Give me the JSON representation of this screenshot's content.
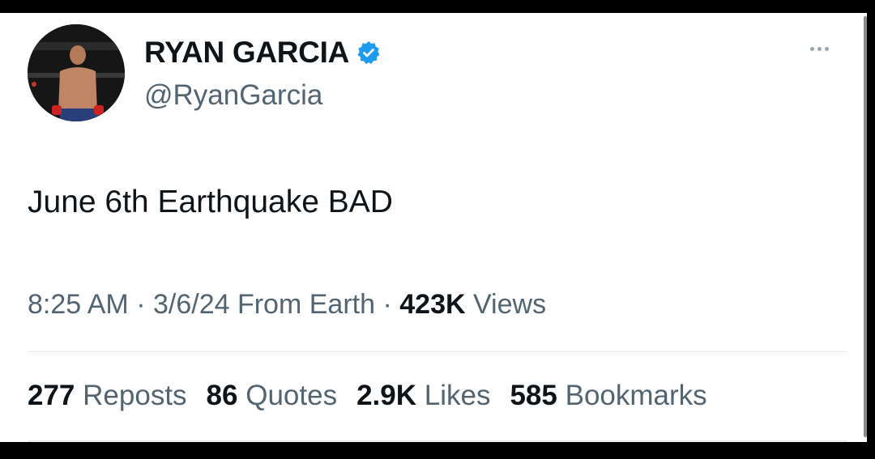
{
  "tweet": {
    "display_name": "RYAN GARCIA",
    "handle": "@RyanGarcia",
    "text": "June 6th Earthquake BAD",
    "time": "8:25 AM",
    "date": "3/6/24",
    "source": "From Earth",
    "views_count": "423K",
    "views_label": "Views",
    "separator": "·"
  },
  "stats": {
    "reposts_count": "277",
    "reposts_label": "Reposts",
    "quotes_count": "86",
    "quotes_label": "Quotes",
    "likes_count": "2.9K",
    "likes_label": "Likes",
    "bookmarks_count": "585",
    "bookmarks_label": "Bookmarks"
  },
  "icons": {
    "verified": "verified-badge-icon",
    "more": "more-options-icon"
  },
  "colors": {
    "verified_blue": "#1d9bf0",
    "text_primary": "#0f1419",
    "text_secondary": "#536471"
  }
}
